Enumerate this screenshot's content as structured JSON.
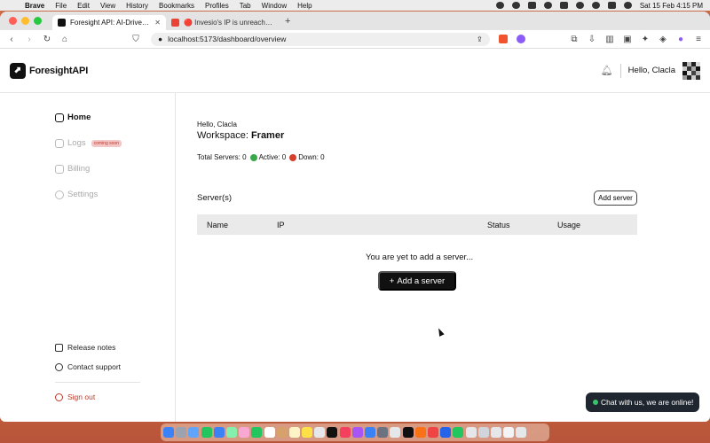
{
  "menubar": {
    "app": "Brave",
    "items": [
      "File",
      "Edit",
      "View",
      "History",
      "Bookmarks",
      "Profiles",
      "Tab",
      "Window",
      "Help"
    ],
    "clock": "Sat 15 Feb  4:15 PM"
  },
  "browser": {
    "tabs": [
      {
        "title": "Foresight API: AI-Driven Serv",
        "active": true
      },
      {
        "title": "🔴 Invesio's IP is unreachable -",
        "active": false
      }
    ],
    "new_tab": "+",
    "url": "localhost:5173/dashboard/overview",
    "shield_count": "1"
  },
  "app": {
    "brand": "ForesightAPI",
    "greeting_header": "Hello, Clacla",
    "sidebar": {
      "items": [
        {
          "label": "Home",
          "icon": "home-icon"
        },
        {
          "label": "Logs",
          "icon": "logs-icon",
          "badge": "coming soon"
        },
        {
          "label": "Billing",
          "icon": "billing-icon"
        },
        {
          "label": "Settings",
          "icon": "settings-icon"
        }
      ],
      "bottom": [
        {
          "label": "Release notes",
          "icon": "release-notes-icon"
        },
        {
          "label": "Contact support",
          "icon": "support-icon"
        }
      ],
      "signout": "Sign out"
    },
    "main": {
      "hello": "Hello, Clacla",
      "workspace_prefix": "Workspace: ",
      "workspace_name": "Framer",
      "stats": {
        "total": "Total Servers: 0",
        "active": "Active: 0",
        "down": "Down: 0"
      },
      "servers_title": "Server(s)",
      "add_server_small": "Add server",
      "columns": [
        "Name",
        "IP",
        "Status",
        "Usage"
      ],
      "empty_text": "You are yet to add a server...",
      "add_server_large": "Add a server"
    },
    "chat": "Chat with us, we are online!"
  },
  "colors": {
    "accent": "#111111",
    "active_dot": "#3aa84a",
    "down_dot": "#d6402b",
    "soon_badge_bg": "#f4c7c7",
    "signout": "#c0392b",
    "chat_bg": "#1f2630"
  }
}
